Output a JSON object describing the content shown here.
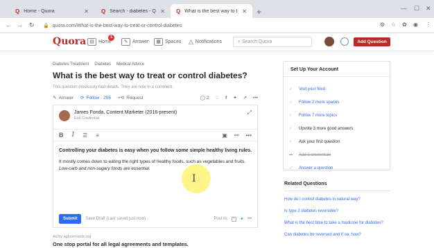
{
  "browser": {
    "tabs": [
      {
        "favicon": "Q",
        "title": "Home - Quora",
        "active": false
      },
      {
        "favicon": "Q",
        "title": "Search - diabetes - Quora",
        "active": false
      },
      {
        "favicon": "Q",
        "title": "What is the best way to treat or c",
        "active": true
      }
    ],
    "url": "quora.com/What-is-the-best-way-to-treat-or-control-diabetes"
  },
  "header": {
    "logo": "Quora",
    "nav": {
      "home": "Home",
      "answer": "Answer",
      "spaces": "Spaces",
      "notifications": "Notifications"
    },
    "notification_count": "1",
    "search_placeholder": "Search Quora",
    "add_question": "Add Question"
  },
  "question": {
    "tags": [
      "Diabetes Treatment",
      "Diabetes",
      "Medical Advice"
    ],
    "title": "What is the best way to treat or control diabetes?",
    "meta": "This question previously had details. They are now in a comment.",
    "actions": {
      "answer": "Answer",
      "follow": "Follow · 205",
      "request": "Request",
      "comments": "2"
    }
  },
  "editor": {
    "author_name": "James Fonda, Content Marketer (2016-present)",
    "author_credential": "Edit Credential",
    "lead": "Controlling your diabetes is easy when you follow some simple healthy living rules.",
    "paragraph_a": "It mostly comes down to eating the right types of healthy foods, such as vegetables and fruits.",
    "paragraph_b": "Low-carb and non-sugary foods are essential.",
    "submit": "Submit",
    "draft": "Save Draft (Last saved just now)",
    "post_to": "Post to:"
  },
  "ad": {
    "by": "Ad by aglreements.org",
    "title": "One stop portal for all legal agreements and templates."
  },
  "setup": {
    "title": "Set Up Your Account",
    "items": [
      {
        "label": "Visit your feed",
        "state": "todo"
      },
      {
        "label": "Follow 2 more spaces",
        "state": "todo"
      },
      {
        "label": "Follow 7 more topics",
        "state": "todo"
      },
      {
        "label": "Upvote 3 more good answers",
        "state": "plain"
      },
      {
        "label": "Ask your first question",
        "state": "plain"
      },
      {
        "label": "Add 3 credentials",
        "state": "done"
      },
      {
        "label": "Answer a question",
        "state": "todo"
      }
    ]
  },
  "related": {
    "title": "Related Questions",
    "items": [
      "How do I control diabetes in natural way?",
      "Is type 2 diabetes reversible?",
      "What is the best time to take a medicine for diabetes?",
      "Can diabetes be reversed and if so, how?"
    ]
  },
  "colors": {
    "brand": "#b92b27",
    "link": "#2e69ff"
  }
}
